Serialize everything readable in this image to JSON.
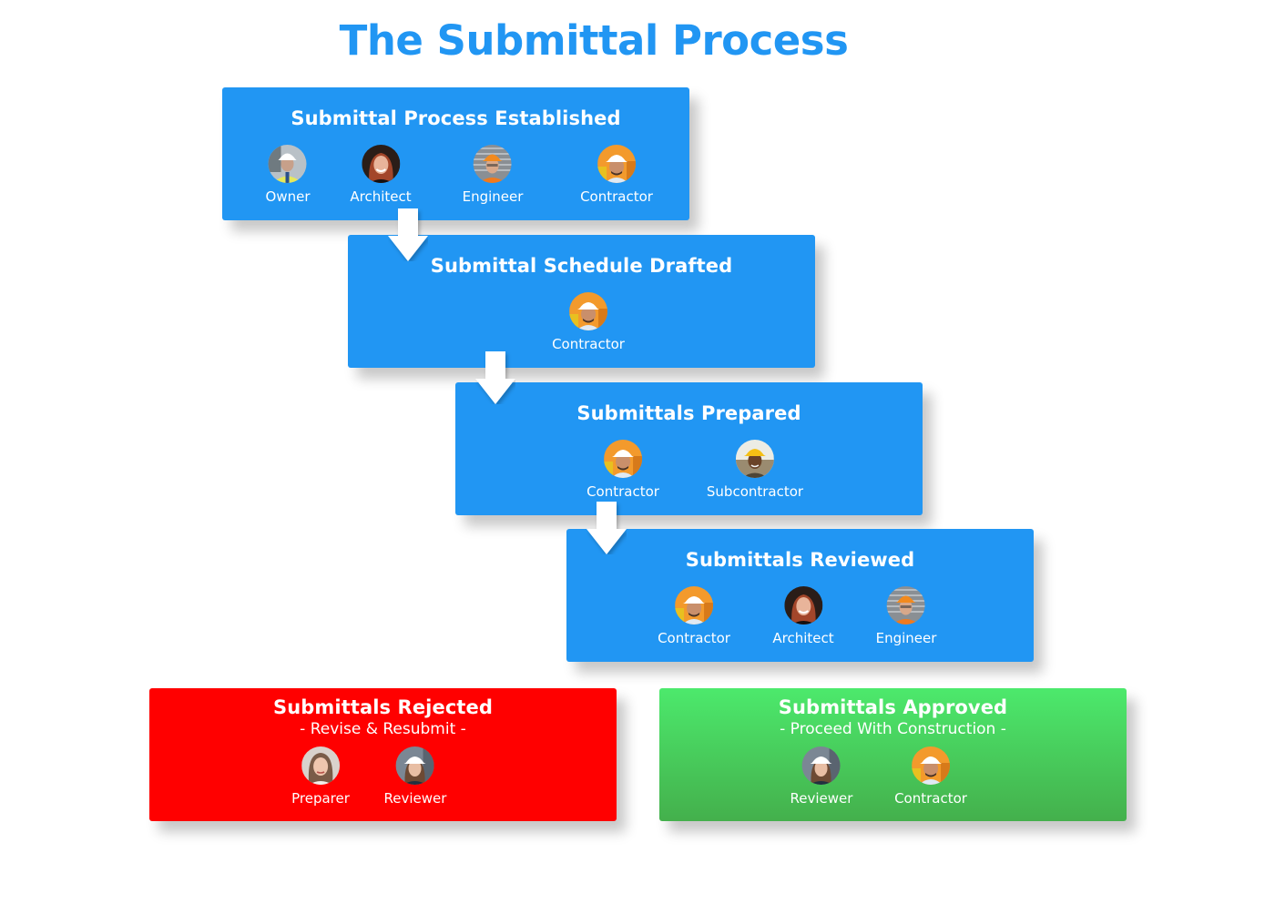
{
  "title": "The Submittal Process",
  "colors": {
    "title": "#2196f3",
    "step": "#2196f3",
    "rejected": "#ff0000",
    "approved_top": "#4ce96c",
    "approved_bottom": "#44b04c",
    "text": "#ffffff"
  },
  "steps": [
    {
      "title": "Submittal Process Established",
      "roles": [
        {
          "label": "Owner",
          "avatar": "owner-avatar"
        },
        {
          "label": "Architect",
          "avatar": "architect-avatar"
        },
        {
          "label": "Engineer",
          "avatar": "engineer-avatar"
        },
        {
          "label": "Contractor",
          "avatar": "contractor-avatar"
        }
      ]
    },
    {
      "title": "Submittal Schedule Drafted",
      "roles": [
        {
          "label": "Contractor",
          "avatar": "contractor-avatar"
        }
      ]
    },
    {
      "title": "Submittals Prepared",
      "roles": [
        {
          "label": "Contractor",
          "avatar": "contractor-avatar"
        },
        {
          "label": "Subcontractor",
          "avatar": "subcontractor-avatar"
        }
      ]
    },
    {
      "title": "Submittals Reviewed",
      "roles": [
        {
          "label": "Contractor",
          "avatar": "contractor-avatar"
        },
        {
          "label": "Architect",
          "avatar": "architect-avatar"
        },
        {
          "label": "Engineer",
          "avatar": "engineer-avatar"
        }
      ]
    }
  ],
  "outcomes": {
    "rejected": {
      "title": "Submittals Rejected",
      "subtitle": "- Revise & Resubmit -",
      "roles": [
        {
          "label": "Preparer",
          "avatar": "preparer-avatar"
        },
        {
          "label": "Reviewer",
          "avatar": "reviewer-avatar"
        }
      ]
    },
    "approved": {
      "title": "Submittals Approved",
      "subtitle": "- Proceed With Construction -",
      "roles": [
        {
          "label": "Reviewer",
          "avatar": "reviewer-avatar"
        },
        {
          "label": "Contractor",
          "avatar": "contractor-avatar"
        }
      ]
    }
  },
  "arrows": [
    {
      "from": "Submittal Process Established",
      "to": "Submittal Schedule Drafted",
      "icon": "arrow-down-icon"
    },
    {
      "from": "Submittal Schedule Drafted",
      "to": "Submittals Prepared",
      "icon": "arrow-down-icon"
    },
    {
      "from": "Submittals Prepared",
      "to": "Submittals Reviewed",
      "icon": "arrow-down-icon"
    }
  ]
}
